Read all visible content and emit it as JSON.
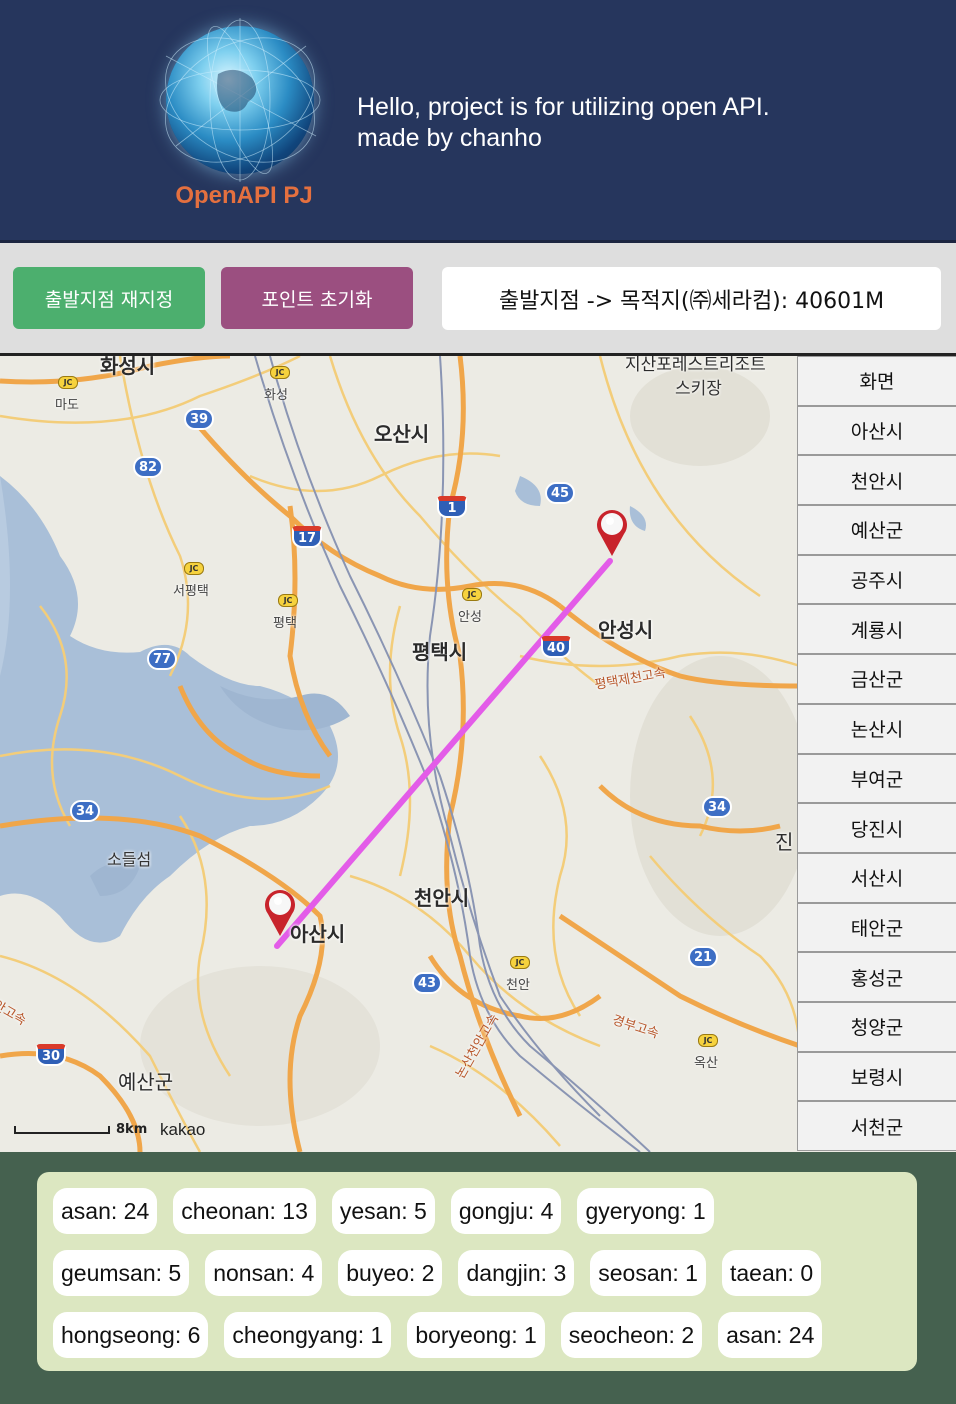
{
  "header": {
    "logo_text": "OpenAPI PJ",
    "greeting_line1": "Hello, project is for utilizing open API.",
    "greeting_line2": "made by chanho",
    "background": "#26365d",
    "logo_color": "#e4703f"
  },
  "toolbar": {
    "reset_start_label": "출발지점 재지정",
    "clear_points_label": "포인트 초기화",
    "distance_text": "출발지점 -> 목적지(㈜세라컴): 40601M",
    "reset_start_color": "#4caf6e",
    "clear_points_color": "#9b4f80"
  },
  "map": {
    "places": {
      "hwaseong_top": "화성시",
      "mado": "마도",
      "hwaseong_jc": "화성",
      "osan": "오산시",
      "jisan": "지산포레스트리조트",
      "ski": "스키장",
      "seopyeongtaek": "서평택",
      "pyeongtaek_jc": "평택",
      "anseong_jc": "안성",
      "pyeongtaek": "평택시",
      "anseong": "안성시",
      "pyeongtaek_expressway": "평택제천고속",
      "sodeulseom": "소들섬",
      "jin": "진",
      "cheonan": "천안시",
      "asan": "아산시",
      "cheonan_jc": "천안",
      "gyeongbu": "경부고속",
      "oksan": "옥산",
      "nonsan_cheonan": "논산천안고속",
      "seohaean": "서해안고속",
      "yesan": "예산군"
    },
    "routes": [
      "39",
      "82",
      "45",
      "1",
      "17",
      "77",
      "40",
      "34",
      "34",
      "21",
      "43",
      "30"
    ],
    "scale_label": "8km",
    "provider": "kakao",
    "line_color": "#e35ce8"
  },
  "regions": [
    {
      "label": "화면"
    },
    {
      "label": "아산시"
    },
    {
      "label": "천안시"
    },
    {
      "label": "예산군"
    },
    {
      "label": "공주시"
    },
    {
      "label": "계룡시"
    },
    {
      "label": "금산군"
    },
    {
      "label": "논산시"
    },
    {
      "label": "부여군"
    },
    {
      "label": "당진시"
    },
    {
      "label": "서산시"
    },
    {
      "label": "태안군"
    },
    {
      "label": "홍성군"
    },
    {
      "label": "청양군"
    },
    {
      "label": "보령시"
    },
    {
      "label": "서천군"
    }
  ],
  "counts": [
    [
      "asan: 24",
      "cheonan: 13",
      "yesan: 5",
      "gongju: 4",
      "gyeryong: 1"
    ],
    [
      "geumsan: 5",
      "nonsan: 4",
      "buyeo: 2",
      "dangjin: 3",
      "seosan: 1",
      "taean: 0"
    ],
    [
      "hongseong: 6",
      "cheongyang: 1",
      "boryeong: 1",
      "seocheon: 2",
      "asan: 24"
    ]
  ]
}
